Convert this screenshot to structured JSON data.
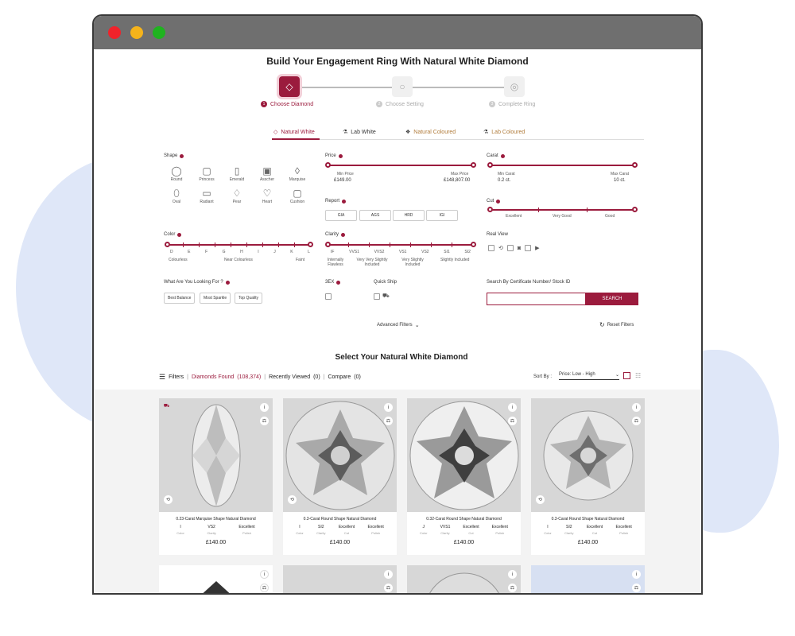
{
  "page_title": "Build Your Engagement Ring With Natural White Diamond",
  "steps": [
    {
      "num": "1",
      "label": "Choose Diamond",
      "icon": "diamond-icon"
    },
    {
      "num": "2",
      "label": "Choose Setting",
      "icon": "ring-setting-icon"
    },
    {
      "num": "3",
      "label": "Complete Ring",
      "icon": "ring-icon"
    }
  ],
  "tabs": [
    "Natural White",
    "Lab White",
    "Natural Coloured",
    "Lab Coloured"
  ],
  "filters": {
    "shape_label": "Shape",
    "shapes": [
      "Round",
      "Princess",
      "Emerald",
      "Asscher",
      "Marquise",
      "Oval",
      "Radiant",
      "Pear",
      "Heart",
      "Cushion"
    ],
    "price_label": "Price",
    "min_price_label": "Min Price",
    "max_price_label": "Max Price",
    "min_price": "£149.00",
    "max_price": "£148,807.00",
    "carat_label": "Carat",
    "min_carat_label": "Min Carat",
    "max_carat_label": "Max Carat",
    "min_carat": "0.2 ct.",
    "max_carat": "10 ct.",
    "report_label": "Report",
    "reports": [
      "GIA",
      "AGS",
      "HRD",
      "IGI"
    ],
    "cut_label": "Cut",
    "cuts": [
      "Excellent",
      "Very Good",
      "Good"
    ],
    "color_label": "Color",
    "colors": [
      "D",
      "E",
      "F",
      "G",
      "H",
      "I",
      "J",
      "K",
      "L"
    ],
    "color_groups": [
      "Colourless",
      "Near Colourless",
      "Faint"
    ],
    "clarity_label": "Clarity",
    "clarities": [
      "IF",
      "VVS1",
      "VVS2",
      "VS1",
      "VS2",
      "SI1",
      "SI2"
    ],
    "clarity_groups": [
      "Internally Flawless",
      "Very Very Slightly Included",
      "Very Slightly Included",
      "Slightly Included"
    ],
    "real_view_label": "Real View",
    "looking_label": "What Are You Looking For ?",
    "looking_options": [
      "Best Balance",
      "Most Sparkle",
      "Top Quality"
    ],
    "three_ex_label": "3EX",
    "quick_ship_label": "Quick Ship",
    "search_label": "Search By Certificate Number/ Stock ID",
    "search_placeholder": "",
    "search_button": "SEARCH",
    "advanced_filters": "Advanced Filters",
    "reset_filters": "Reset Filters"
  },
  "results": {
    "heading": "Select Your Natural White Diamond",
    "filters_label": "Filters",
    "found_label": "Diamonds Found",
    "found_count": "(108,374)",
    "recently_viewed_label": "Recently Viewed",
    "recently_viewed_count": "(0)",
    "compare_label": "Compare",
    "compare_count": "(0)",
    "sort_label": "Sort By :",
    "sort_value": "Price: Low - High"
  },
  "cards": [
    {
      "title": "0.23-Carat Marquise Shape Natural Diamond",
      "color": "I",
      "clarity": "VS2",
      "cut": null,
      "polish": "Excellent",
      "price": "£140.00"
    },
    {
      "title": "0.3-Carat Round Shape Natural Diamond",
      "color": "I",
      "clarity": "SI2",
      "cut": "Excellent",
      "polish": "Excellent",
      "price": "£140.00"
    },
    {
      "title": "0.32-Carat Round Shape Natural Diamond",
      "color": "J",
      "clarity": "VVS1",
      "cut": "Excellent",
      "polish": "Excellent",
      "price": "£140.00"
    },
    {
      "title": "0.3-Carat Round Shape Natural Diamond",
      "color": "I",
      "clarity": "SI2",
      "cut": "Excellent",
      "polish": "Excellent",
      "price": "£140.00"
    }
  ],
  "spec_labels": {
    "color": "Color",
    "clarity": "Clarity",
    "cut": "Cut",
    "polish": "Polish"
  },
  "accent_color": "#9b1b3d"
}
